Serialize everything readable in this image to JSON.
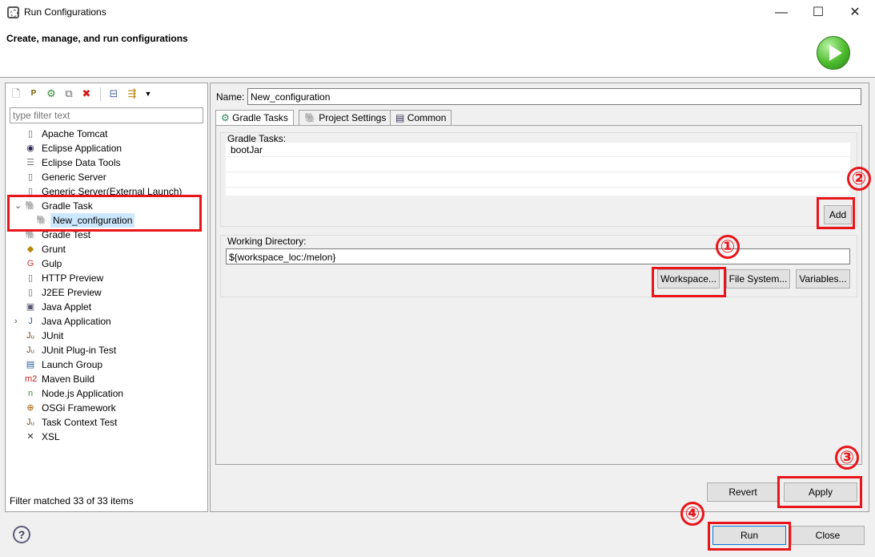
{
  "window": {
    "title": "Run Configurations",
    "minimize": "—",
    "maximize": "☐",
    "close": "✕"
  },
  "header": {
    "title": "Create, manage, and run configurations"
  },
  "left": {
    "filter_placeholder": "type filter text",
    "tree": [
      {
        "label": "Apache Tomcat",
        "icon": "tomcat-icon"
      },
      {
        "label": "Eclipse Application",
        "icon": "eclipse-icon"
      },
      {
        "label": "Eclipse Data Tools",
        "icon": "database-icon"
      },
      {
        "label": "Generic Server",
        "icon": "server-icon"
      },
      {
        "label": "Generic Server(External Launch)",
        "icon": "server-icon"
      },
      {
        "label": "Gradle Task",
        "icon": "gradle-icon",
        "expanded": true
      },
      {
        "label": "New_configuration",
        "icon": "gradle-icon",
        "child": true,
        "selected": true
      },
      {
        "label": "Gradle Test",
        "icon": "gradle-icon"
      },
      {
        "label": "Grunt",
        "icon": "grunt-icon"
      },
      {
        "label": "Gulp",
        "icon": "gulp-icon"
      },
      {
        "label": "HTTP Preview",
        "icon": "server-icon"
      },
      {
        "label": "J2EE Preview",
        "icon": "server-icon"
      },
      {
        "label": "Java Applet",
        "icon": "applet-icon"
      },
      {
        "label": "Java Application",
        "icon": "java-app-icon",
        "collapsed": true
      },
      {
        "label": "JUnit",
        "icon": "junit-icon"
      },
      {
        "label": "JUnit Plug-in Test",
        "icon": "junit-icon"
      },
      {
        "label": "Launch Group",
        "icon": "launch-group-icon"
      },
      {
        "label": "Maven Build",
        "icon": "maven-icon"
      },
      {
        "label": "Node.js Application",
        "icon": "nodejs-icon"
      },
      {
        "label": "OSGi Framework",
        "icon": "osgi-icon"
      },
      {
        "label": "Task Context Test",
        "icon": "junit-icon"
      },
      {
        "label": "XSL",
        "icon": "xsl-icon"
      }
    ],
    "filter_status": "Filter matched 33 of 33 items"
  },
  "right": {
    "name_label": "Name:",
    "name_value": "New_configuration",
    "tabs": [
      {
        "label": "Gradle Tasks"
      },
      {
        "label": "Project Settings"
      },
      {
        "label": "Common"
      }
    ],
    "gradle_tasks_label": "Gradle Tasks:",
    "gradle_tasks": [
      "bootJar"
    ],
    "add_button": "Add",
    "working_dir_label": "Working Directory:",
    "working_dir_value": "${workspace_loc:/melon}",
    "workspace_button": "Workspace...",
    "filesystem_button": "File System...",
    "variables_button": "Variables...",
    "revert_button": "Revert",
    "apply_button": "Apply"
  },
  "footer": {
    "help": "?",
    "run_button": "Run",
    "close_button": "Close"
  },
  "annotations": [
    "①",
    "②",
    "③",
    "④"
  ],
  "colors": {
    "highlight": "#e8161b",
    "selection": "#cce8ff",
    "default_button_border": "#0078d7"
  }
}
